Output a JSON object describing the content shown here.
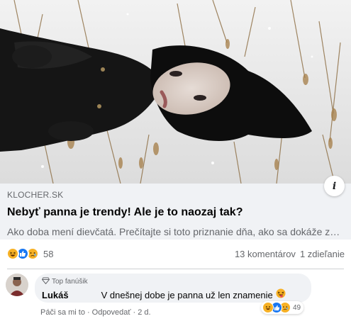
{
  "link_preview": {
    "domain": "KLOCHER.SK",
    "headline": "Nebyť panna je trendy! Ale je to naozaj tak?",
    "description": "Ako doba mení dievčatá. Prečítajte si toto priznanie dňa, ako sa dokáže zmeniť...",
    "info_icon": "info-icon"
  },
  "post_stats": {
    "reactions": [
      "haha",
      "like",
      "sad"
    ],
    "reaction_count": "58",
    "comments": "13 komentárov",
    "shares": "1 zdieľanie"
  },
  "comment": {
    "badge": "Top fanúšik",
    "author": "Lukáš",
    "text": "V dnešnej dobe je panna už len znamenie",
    "reactions": [
      "haha",
      "like",
      "sad"
    ],
    "reaction_count": "49",
    "like_action": "Páči sa mi to",
    "reply_action": "Odpovedať",
    "age": "2 d."
  },
  "colors": {
    "like_blue": "#1877f2",
    "haha_yellow": "#f7b125",
    "meta_gray": "#65676b",
    "card_bg": "#f0f2f5"
  }
}
